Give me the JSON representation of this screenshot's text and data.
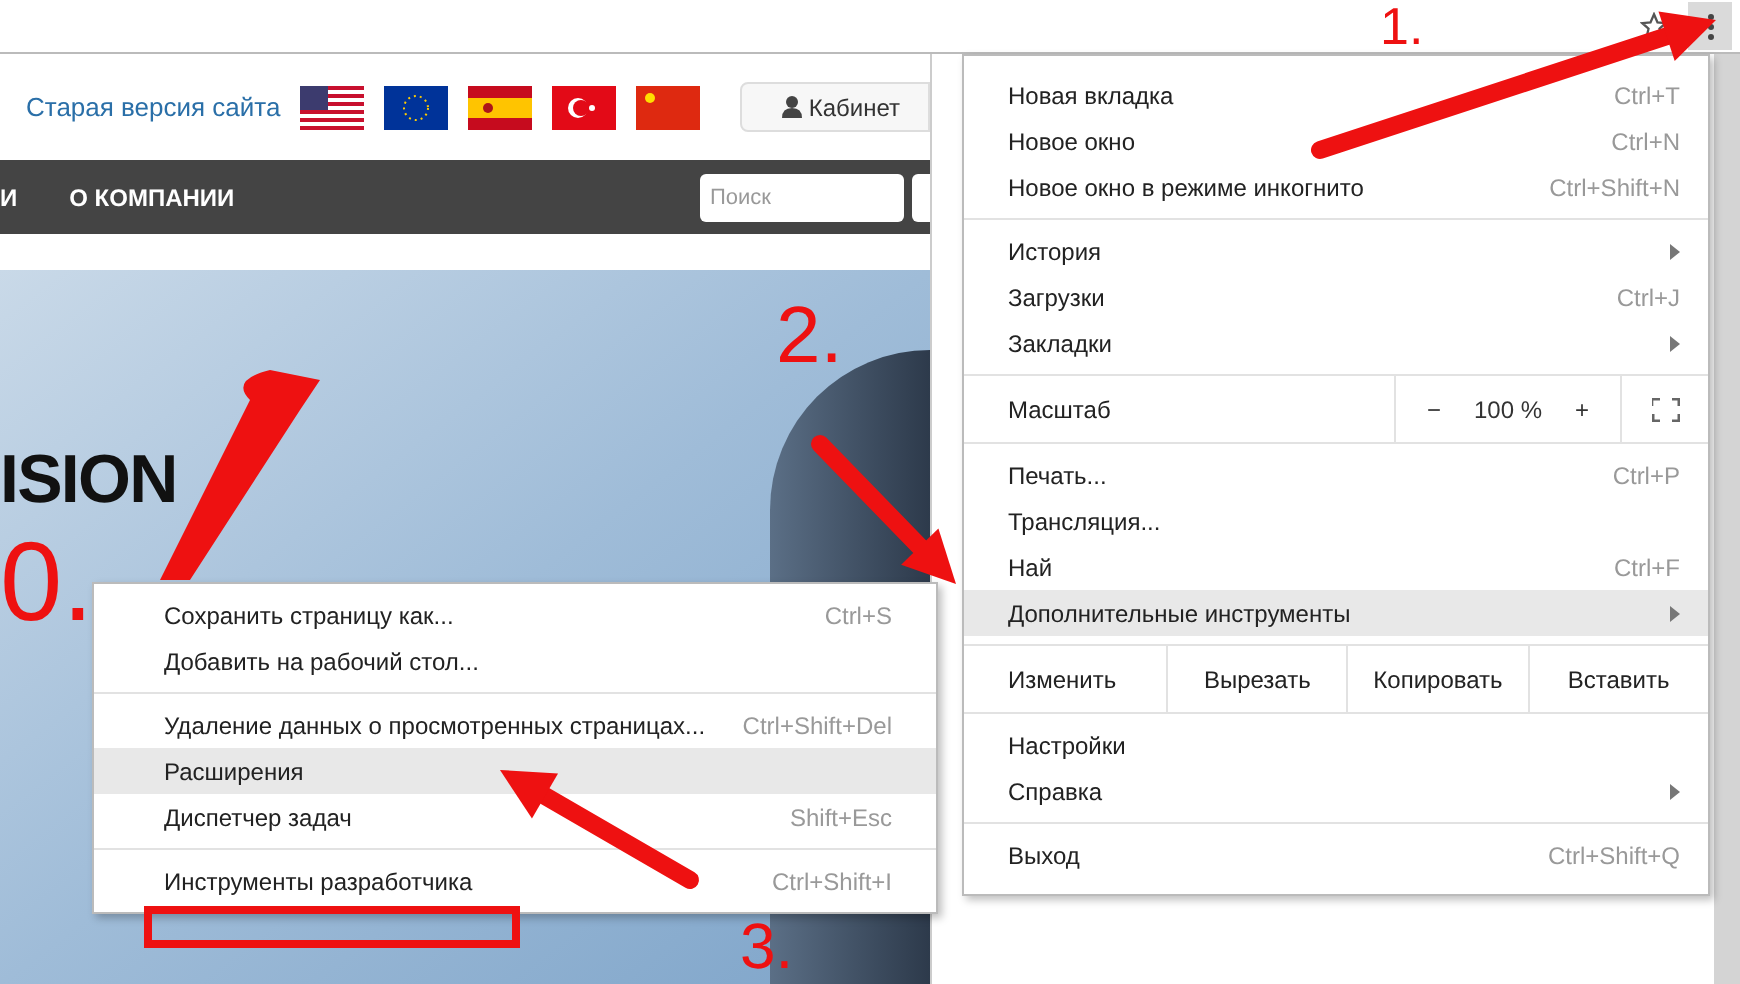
{
  "site": {
    "old_version_link": "Старая версия сайта",
    "cabinet_button": "Кабинет",
    "nav_items": [
      {
        "label": "И"
      },
      {
        "label": "О КОМПАНИИ"
      }
    ],
    "search": {
      "placeholder": "Поиск"
    },
    "hero": {
      "title": "ISION",
      "red_text": "0."
    }
  },
  "menu": {
    "sections": [
      {
        "kind": "items",
        "items": [
          {
            "label": "Новая вкладка",
            "shortcut": "Ctrl+T",
            "submenu": false,
            "selected": false
          },
          {
            "label": "Новое окно",
            "shortcut": "Ctrl+N",
            "submenu": false,
            "selected": false
          },
          {
            "label": "Новое окно в режиме инкогнито",
            "shortcut": "Ctrl+Shift+N",
            "submenu": false,
            "selected": false
          }
        ]
      },
      {
        "kind": "items",
        "items": [
          {
            "label": "История",
            "submenu": true,
            "selected": false
          },
          {
            "label": "Загрузки",
            "shortcut": "Ctrl+J",
            "submenu": false,
            "selected": false
          },
          {
            "label": "Закладки",
            "submenu": true,
            "selected": false
          }
        ]
      },
      {
        "kind": "zoom",
        "label": "Масштаб",
        "minus": "−",
        "value": "100 %",
        "plus": "+"
      },
      {
        "kind": "items",
        "items": [
          {
            "label": "Печать...",
            "shortcut": "Ctrl+P",
            "submenu": false,
            "selected": false
          },
          {
            "label": "Трансляция...",
            "submenu": false,
            "selected": false
          },
          {
            "label": "Най",
            "shortcut": "Ctrl+F",
            "submenu": false,
            "selected": false
          },
          {
            "label": "Дополнительные инструменты",
            "submenu": true,
            "selected": true
          }
        ]
      },
      {
        "kind": "edit",
        "label": "Изменить",
        "buttons": [
          "Вырезать",
          "Копировать",
          "Вставить"
        ]
      },
      {
        "kind": "items",
        "items": [
          {
            "label": "Настройки",
            "submenu": false,
            "selected": false
          },
          {
            "label": "Справка",
            "submenu": true,
            "selected": false
          }
        ]
      },
      {
        "kind": "items",
        "items": [
          {
            "label": "Выход",
            "shortcut": "Ctrl+Shift+Q",
            "submenu": false,
            "selected": false
          }
        ]
      }
    ]
  },
  "submenu": {
    "sections": [
      [
        {
          "label": "Сохранить страницу как...",
          "shortcut": "Ctrl+S",
          "selected": false
        },
        {
          "label": "Добавить на рабочий стол...",
          "selected": false
        }
      ],
      [
        {
          "label": "Удаление данных о просмотренных страницах...",
          "shortcut": "Ctrl+Shift+Del",
          "selected": false
        },
        {
          "label": "Расширения",
          "selected": true
        },
        {
          "label": "Диспетчер задач",
          "shortcut": "Shift+Esc",
          "selected": false
        }
      ],
      [
        {
          "label": "Инструменты разработчика",
          "shortcut": "Ctrl+Shift+I",
          "selected": false
        }
      ]
    ]
  },
  "annotations": [
    "1.",
    "2.",
    "3."
  ]
}
